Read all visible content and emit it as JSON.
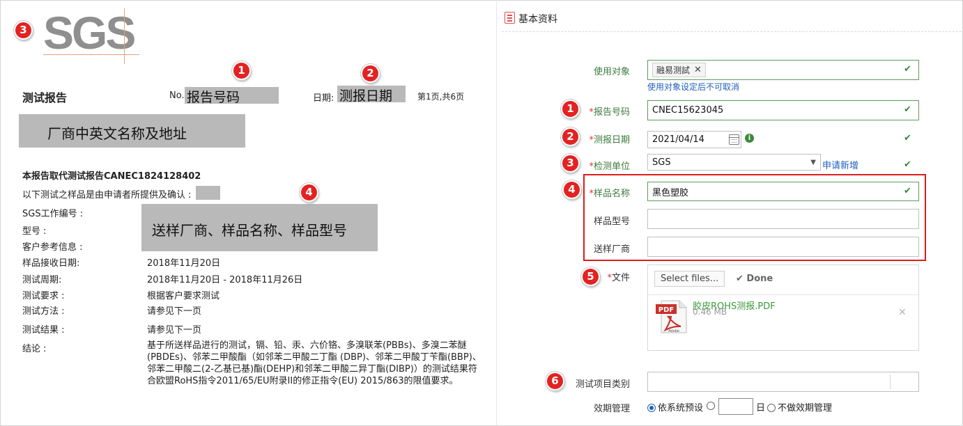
{
  "report": {
    "logo": "SGS",
    "title": "测试报告",
    "report_no_label": "No.",
    "report_no_value": "报告号码",
    "date_label": "日期:",
    "date_value": "测报日期",
    "page_info": "第1页,共6页",
    "vendor_block": "厂商中英文名称及地址",
    "replace_note": "本报告取代测试报告CANEC1824128402",
    "sample_note": "以下测试之样品是由申请者所提供及确认 :",
    "job_no_label": "SGS工作编号 :",
    "model_label": "型号 :",
    "client_ref_label": "客户参考信息 :",
    "sample_block": "送样厂商、样品名称、样品型号",
    "receive_date_label": "样品接收日期:",
    "receive_date_value": "2018年11月20日",
    "period_label": "测试周期:",
    "period_value": "2018年11月20日 - 2018年11月26日",
    "requirement_label": "测试要求 :",
    "requirement_value": "根据客户要求测试",
    "method_label": "测试方法 :",
    "method_value": "请参见下一页",
    "result_label": "测试结果 :",
    "result_value": "请参见下一页",
    "conclusion_label": "结论 :",
    "conclusion_value": "基于所送样品进行的测试，镉、铅、汞、六价铬、多溴联苯(PBBs)、多溴二苯醚(PBDEs)、邻苯二甲酸酯（如邻苯二甲酸二丁酯 (DBP)、邻苯二甲酸丁苄酯(BBP)、邻苯二甲酸二(2-乙基已基)酯(DEHP)和邻苯二甲酸二异丁酯(DIBP)）的测试结果符合欧盟RoHS指令2011/65/EU附录II的修正指令(EU) 2015/863的限值要求。"
  },
  "badges": {
    "b1": "1",
    "b2": "2",
    "b3": "3",
    "b4": "4",
    "b5": "5",
    "b6": "6"
  },
  "form": {
    "panel_title": "基本资料",
    "target_label": "使用对象",
    "target_tag": "融易测試",
    "target_note": "使用对象设定后不可取消",
    "report_no_label": "报告号码",
    "report_no_value": "CNEC15623045",
    "date_label": "测报日期",
    "date_value": "2021/04/14",
    "unit_label": "检测单位",
    "unit_value": "SGS",
    "unit_link": "申请新增",
    "sample_name_label": "样品名称",
    "sample_name_value": "黑色塑胶",
    "sample_model_label": "样品型号",
    "sample_model_value": "",
    "sender_label": "送样厂商",
    "sender_value": "",
    "file_label": "文件",
    "select_files": "Select files...",
    "done": "Done",
    "file_name": "胶皮ROHS测报.PDF",
    "file_size": "0.46 MB",
    "pdf_icon_text": "PDF",
    "pdf_brand": "Adobe",
    "category_label": "测试项目类别",
    "category_value": "",
    "validity_label": "效期管理",
    "validity_opt1": "依系统预设",
    "validity_day_unit": "日",
    "validity_opt3": "不做效期管理"
  },
  "colors": {
    "badge": "#e32222",
    "label_green": "#3c7a3c",
    "check_green": "#2e8b3a",
    "link_blue": "#1f5fbf",
    "highlight_red": "#e01b1b"
  }
}
